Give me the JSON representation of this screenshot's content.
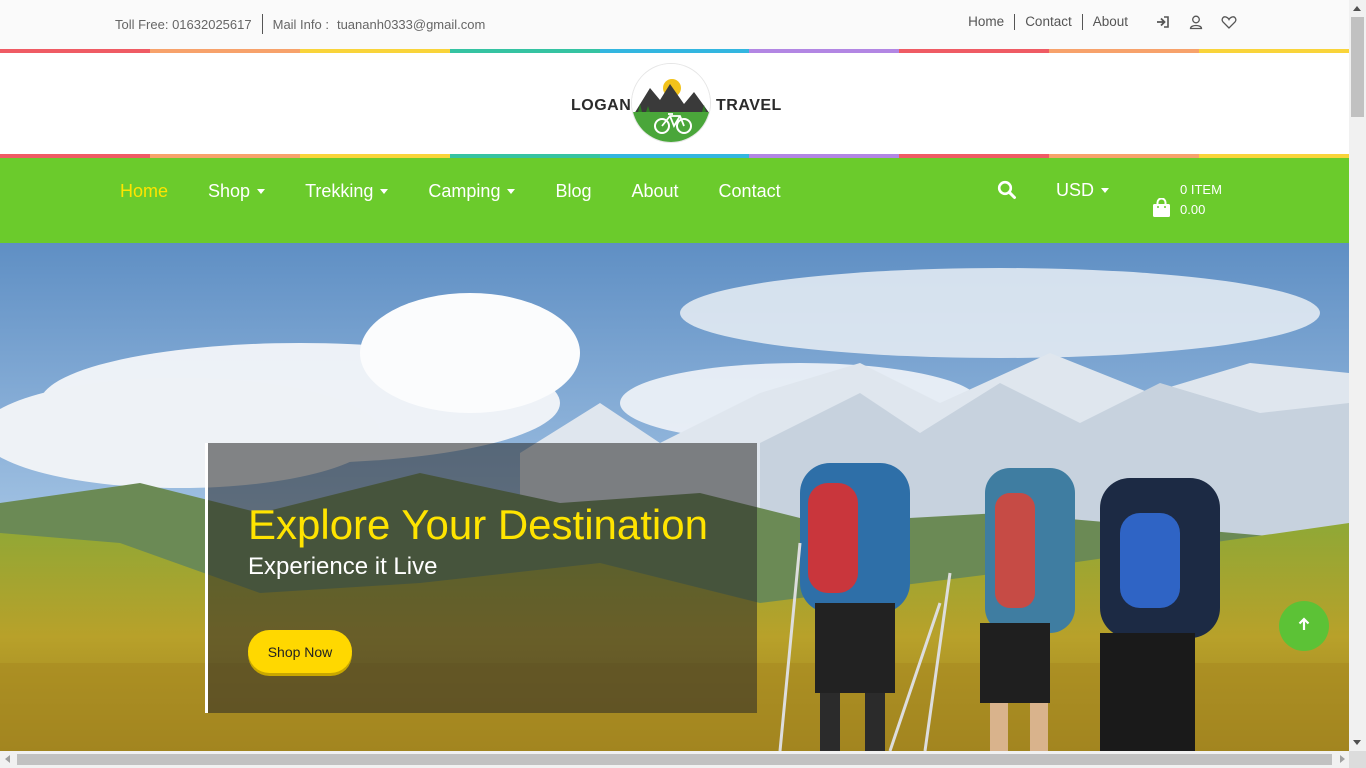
{
  "topbar": {
    "toll_free": "Toll Free: 01632025617",
    "mail_label": "Mail Info :",
    "mail_value": "tuananh0333@gmail.com",
    "links": [
      "Home",
      "Contact",
      "About"
    ],
    "icons": [
      "sign-in-icon",
      "user-icon",
      "heart-icon"
    ]
  },
  "rainbow_colors": [
    "#ef5b64",
    "#f7a26b",
    "#f9d43a",
    "#35c3a2",
    "#33b6e0",
    "#b286e3",
    "#ef5b64",
    "#f7a26b",
    "#f9d43a"
  ],
  "logo": {
    "left_word": "LOGAN",
    "right_word": "TRAVEL",
    "badge_icon": "mountain-bike-logo"
  },
  "nav": {
    "items": [
      {
        "label": "Home",
        "active": true,
        "dropdown": false
      },
      {
        "label": "Shop",
        "active": false,
        "dropdown": true
      },
      {
        "label": "Trekking",
        "active": false,
        "dropdown": true
      },
      {
        "label": "Camping",
        "active": false,
        "dropdown": true
      },
      {
        "label": "Blog",
        "active": false,
        "dropdown": false
      },
      {
        "label": "About",
        "active": false,
        "dropdown": false
      },
      {
        "label": "Contact",
        "active": false,
        "dropdown": false
      }
    ],
    "currency": "USD",
    "cart_items": "0 ITEM",
    "cart_total": "0.00",
    "search_icon": "search-icon",
    "cart_icon": "shopping-bag-icon",
    "bg_color": "#6bcb2c",
    "active_color": "#ffe400"
  },
  "hero": {
    "title": "Explore Your Destination",
    "subtitle": "Experience it Live",
    "button": "Shop Now"
  },
  "to_top_icon": "arrow-up-icon"
}
